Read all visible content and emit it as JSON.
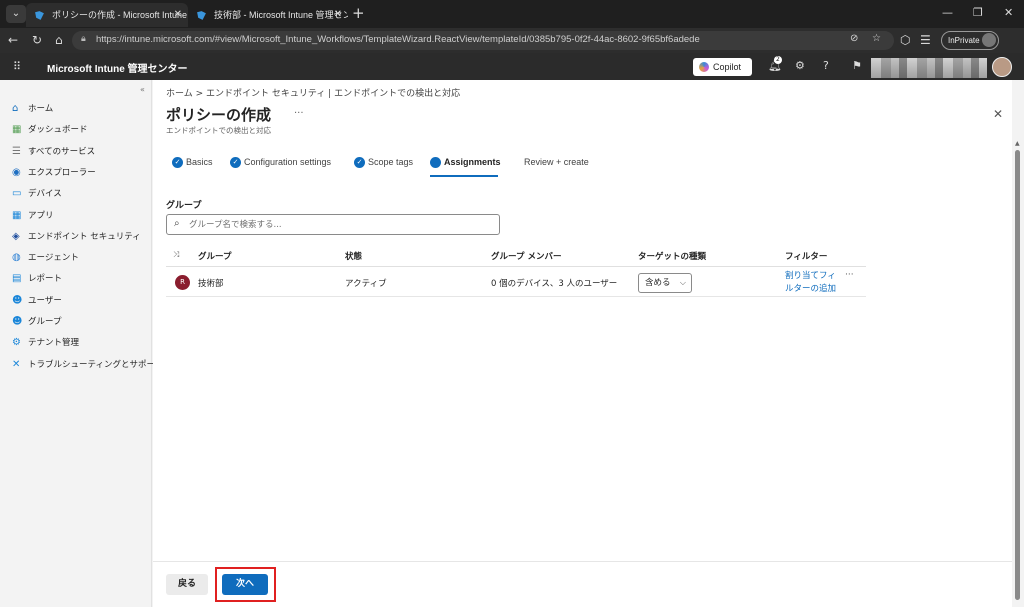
{
  "browser": {
    "tabs": [
      {
        "title": "ポリシーの作成 - Microsoft Intune 管理センター",
        "active": true
      },
      {
        "title": "技術部 - Microsoft Intune 管理センター",
        "active": false
      }
    ],
    "url": "https://intune.microsoft.com/#view/Microsoft_Intune_Workflows/TemplateWizard.ReactView/templateId/0385b795-0f2f-44ac-8602-9f65bf6adede",
    "inprivate_label": "InPrivate"
  },
  "app": {
    "title": "Microsoft Intune 管理センター",
    "copilot_label": "Copilot",
    "notification_count": "2"
  },
  "sidebar": {
    "items": [
      {
        "label": "ホーム",
        "icon": "home-icon",
        "color": "#0f6cbd"
      },
      {
        "label": "ダッシュボード",
        "icon": "dashboard-icon",
        "color": "#5aa15a"
      },
      {
        "label": "すべてのサービス",
        "icon": "list-icon",
        "color": "#777777"
      },
      {
        "label": "エクスプローラー",
        "icon": "explorer-icon",
        "color": "#1f6fc2"
      },
      {
        "label": "デバイス",
        "icon": "devices-icon",
        "color": "#1a86d9"
      },
      {
        "label": "アプリ",
        "icon": "apps-icon",
        "color": "#1a86d9"
      },
      {
        "label": "エンドポイント セキュリティ",
        "icon": "endpoint-security-icon",
        "color": "#1f4e9e"
      },
      {
        "label": "エージェント",
        "icon": "agents-icon",
        "color": "#2a7fd4"
      },
      {
        "label": "レポート",
        "icon": "reports-icon",
        "color": "#1a86d9"
      },
      {
        "label": "ユーザー",
        "icon": "users-icon",
        "color": "#1a86d9"
      },
      {
        "label": "グループ",
        "icon": "groups-icon",
        "color": "#1a86d9"
      },
      {
        "label": "テナント管理",
        "icon": "tenant-admin-icon",
        "color": "#1a86d9"
      },
      {
        "label": "トラブルシューティングとサポート",
        "icon": "troubleshoot-icon",
        "color": "#1a86d9"
      }
    ]
  },
  "page": {
    "breadcrumb": "ホーム  >  エンドポイント セキュリティ | エンドポイントでの検出と対応",
    "title": "ポリシーの作成",
    "subtitle": "エンドポイントでの検出と対応",
    "steps": [
      {
        "label": "Basics",
        "state": "done"
      },
      {
        "label": "Configuration settings",
        "state": "done"
      },
      {
        "label": "Scope tags",
        "state": "done"
      },
      {
        "label": "Assignments",
        "state": "active"
      },
      {
        "label": "Review + create",
        "state": "pending"
      }
    ],
    "group_section_label": "グループ",
    "search_placeholder": "グループ名で検索する...",
    "table": {
      "headers": [
        "グループ",
        "状態",
        "グループ メンバー",
        "ターゲットの種類",
        "フィルター"
      ],
      "rows": [
        {
          "avatar_letter": "R",
          "group": "技術部",
          "status": "アクティブ",
          "members": "0 個のデバイス、3 人のユーザー",
          "target_type": "含める",
          "filter_link": "割り当てフィルターの追加"
        }
      ]
    },
    "footer": {
      "back_label": "戻る",
      "next_label": "次へ"
    }
  },
  "colors": {
    "accent": "#0f6cbd",
    "highlight_frame": "#e02020"
  }
}
